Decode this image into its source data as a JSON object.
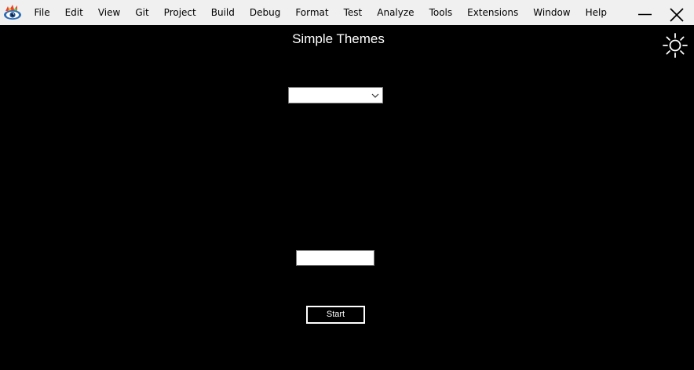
{
  "menu": {
    "items": [
      {
        "label": "File"
      },
      {
        "label": "Edit"
      },
      {
        "label": "View"
      },
      {
        "label": "Git"
      },
      {
        "label": "Project"
      },
      {
        "label": "Build"
      },
      {
        "label": "Debug"
      },
      {
        "label": "Format"
      },
      {
        "label": "Test"
      },
      {
        "label": "Analyze"
      },
      {
        "label": "Tools"
      },
      {
        "label": "Extensions"
      },
      {
        "label": "Window"
      },
      {
        "label": "Help"
      }
    ]
  },
  "icons": {
    "app": "eye-app-icon",
    "minimize": "minimize-icon",
    "close": "close-icon",
    "theme_toggle": "sun-icon",
    "dropdown_chevron": "chevron-down-icon"
  },
  "main": {
    "title": "Simple Themes",
    "theme_select": {
      "value": ""
    },
    "text_input": {
      "value": "",
      "placeholder": ""
    },
    "start_label": "Start"
  },
  "colors": {
    "titlebar_bg": "#f0f0f0",
    "content_bg": "#000000",
    "foreground": "#ffffff"
  }
}
